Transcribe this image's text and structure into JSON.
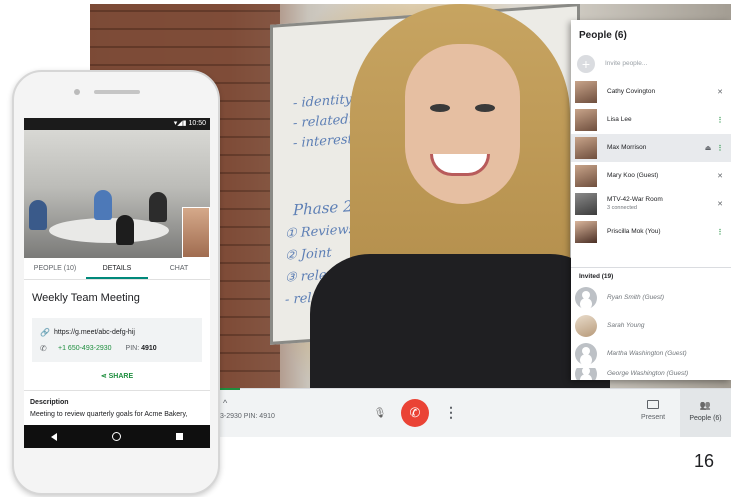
{
  "desktop": {
    "meeting_info": "3-2930 PIN: 4910",
    "caret": "^",
    "mic_icon": "🎙",
    "end_icon": "✆",
    "more_icon": "⋮",
    "present_label": "Present",
    "people_label": "People (6)",
    "people_icon": "👥",
    "whiteboard_lines": [
      "- identity",
      "- relatedness",
      "- interest",
      "Phase 2",
      "① Reviews",
      "② Joint",
      "③ relevant",
      "   - relevant"
    ]
  },
  "people_panel": {
    "title": "People (6)",
    "invite_placeholder": "Invite people...",
    "participants": [
      {
        "name": "Cathy Covington",
        "sub": "",
        "icon": "mic-off"
      },
      {
        "name": "Lisa Lee",
        "sub": "",
        "icon": "more"
      },
      {
        "name": "Max Morrison",
        "sub": "",
        "icon": "eject-more"
      },
      {
        "name": "Mary Koo (Guest)",
        "sub": "",
        "icon": "mic-off"
      },
      {
        "name": "MTV-42-War Room",
        "sub": "3 connected",
        "icon": "mic-off"
      },
      {
        "name": "Priscilla Mok (You)",
        "sub": "",
        "icon": "more"
      }
    ],
    "invited_title": "Invited (19)",
    "invited": [
      {
        "name": "Ryan Smith (Guest)"
      },
      {
        "name": "Sarah Young"
      },
      {
        "name": "Martha Washington (Guest)"
      },
      {
        "name": "George Washington (Guest)"
      }
    ]
  },
  "phone": {
    "time": "10:50",
    "tabs": [
      "PEOPLE (10)",
      "DETAILS",
      "CHAT"
    ],
    "meeting_title": "Weekly Team Meeting",
    "link": "https://g.meet/abc-defg-hij",
    "phone_number": "+1 650-493-2930",
    "pin_label": "PIN:",
    "pin_value": "4910",
    "share_label": "SHARE",
    "description_title": "Description",
    "description_text": "Meeting to review quarterly goals for Acme Bakery,"
  },
  "page_number": "16",
  "colors": {
    "accent_green": "#1e8e3e",
    "end_call_red": "#ea4335",
    "tab_teal": "#00897b"
  }
}
